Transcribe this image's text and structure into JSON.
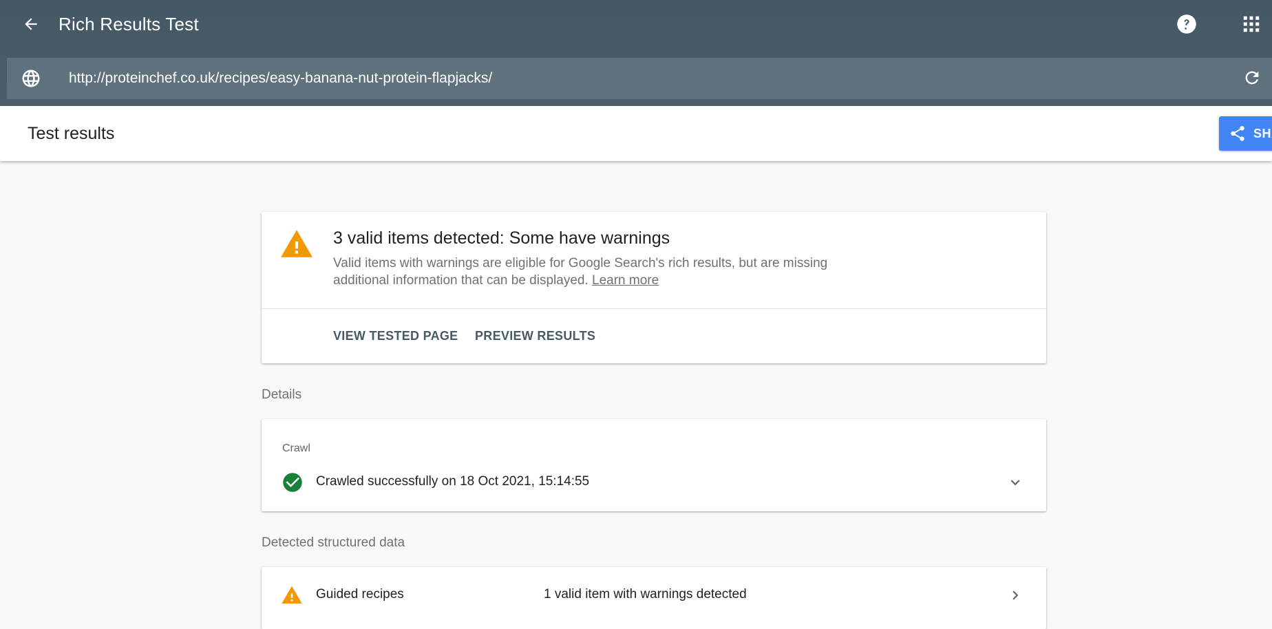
{
  "app": {
    "title": "Rich Results Test"
  },
  "url_bar": {
    "url": "http://proteinchef.co.uk/recipes/easy-banana-nut-protein-flapjacks/"
  },
  "results_bar": {
    "heading": "Test results",
    "share_label": "SHARE"
  },
  "summary": {
    "title": "3 valid items detected: Some have warnings",
    "description": "Valid items with warnings are eligible for Google Search's rich results, but are missing additional information that can be displayed.",
    "learn_more": "Learn more",
    "actions": [
      "VIEW TESTED PAGE",
      "PREVIEW RESULTS"
    ]
  },
  "details": {
    "section_label": "Details",
    "crawl_label": "Crawl",
    "crawl_status": "Crawled successfully on 18 Oct 2021, 15:14:55"
  },
  "detected": {
    "section_label": "Detected structured data",
    "items": [
      {
        "name": "Guided recipes",
        "status": "1 valid item with warnings detected"
      }
    ]
  },
  "colors": {
    "appbar": "#445865",
    "urlbar": "#5f717c",
    "share": "#4285f4",
    "warning": "#f29900",
    "success": "#188038"
  },
  "icons": [
    "back-arrow-icon",
    "help-icon",
    "apps-grid-icon",
    "globe-icon",
    "refresh-icon",
    "share-icon",
    "warning-icon",
    "check-circle-icon",
    "chevron-down-icon",
    "chevron-right-icon"
  ]
}
